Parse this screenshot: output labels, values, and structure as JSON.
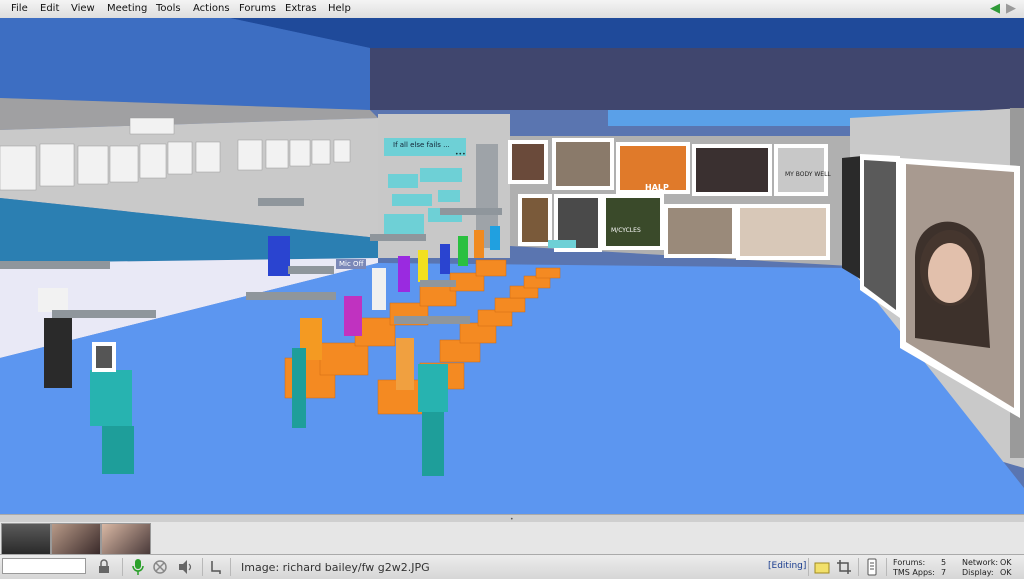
{
  "menu": {
    "items": [
      "File",
      "Edit",
      "View",
      "Meeting",
      "Tools",
      "Actions",
      "Forums",
      "Extras",
      "Help"
    ]
  },
  "nav": {
    "back_icon": "back-arrow-icon",
    "forward_icon": "forward-arrow-icon"
  },
  "scene": {
    "panel_title": "If all else fails ...",
    "mic_label": "Mic Off",
    "panel_captions": [
      "HALP",
      "MY BODY WELL",
      "M/CYCLES"
    ]
  },
  "status": {
    "image_path": "Image: richard bailey/fw g2w2.JPG",
    "editing": "[Editing]",
    "forums_label": "Forums:",
    "forums_count": "5",
    "tms_label": "TMS Apps:",
    "tms_count": "7",
    "network_label": "Network:",
    "network_value": "OK",
    "display_label": "Display:",
    "display_value": "OK"
  },
  "colors": {
    "floor": "#5c96f0",
    "ceiling": "#2d56a8",
    "accent_green": "#2e9a38",
    "editing_text": "#1a3d8f"
  }
}
